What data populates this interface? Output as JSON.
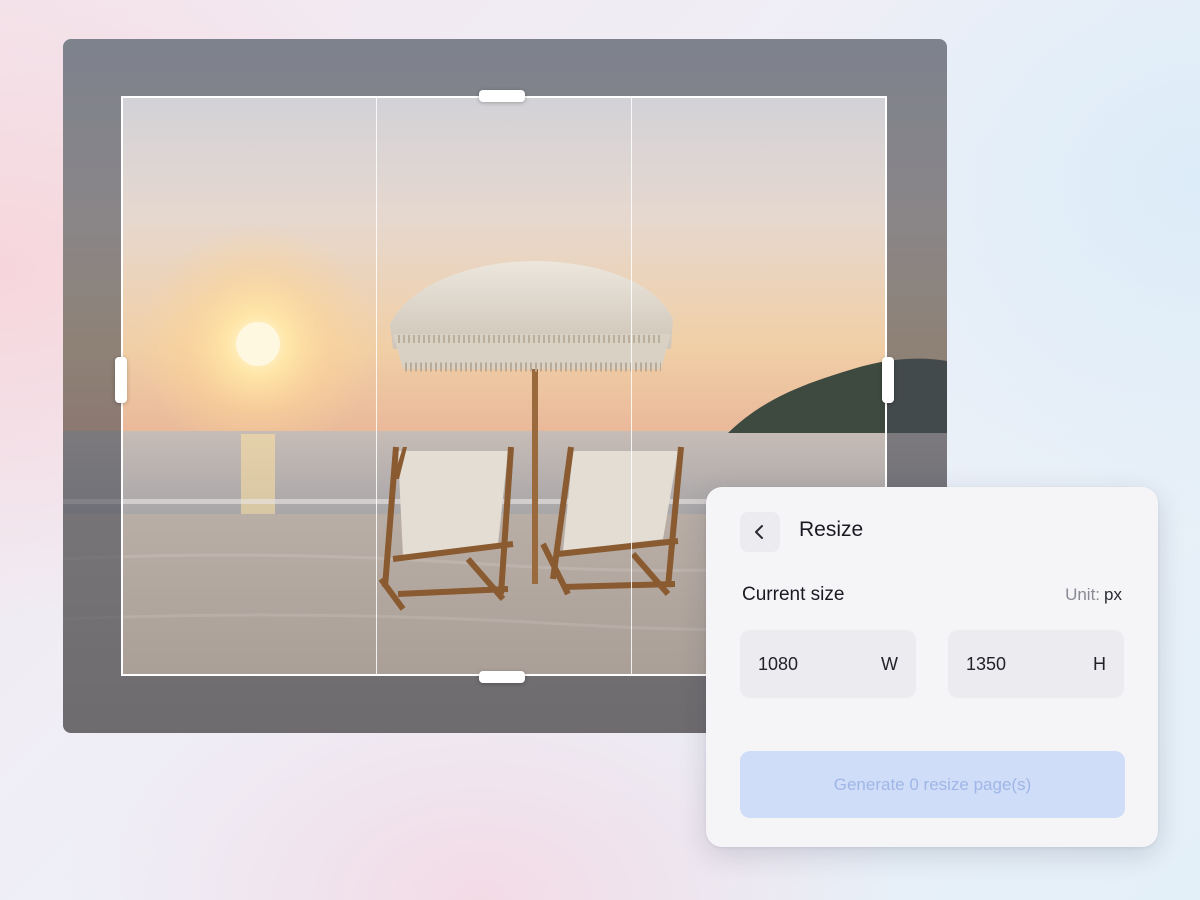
{
  "panel": {
    "title": "Resize",
    "back_icon": "chevron-left-icon",
    "section_label": "Current size",
    "unit_label": "Unit:",
    "unit_value": "px",
    "width_value": "1080",
    "width_suffix": "W",
    "height_value": "1350",
    "height_suffix": "H",
    "generate_label": "Generate 0 resize page(s)"
  },
  "colors": {
    "button_disabled_bg": "#cfddf8",
    "button_disabled_text": "#9fb6e6",
    "crop_frame": "#ffffff"
  }
}
